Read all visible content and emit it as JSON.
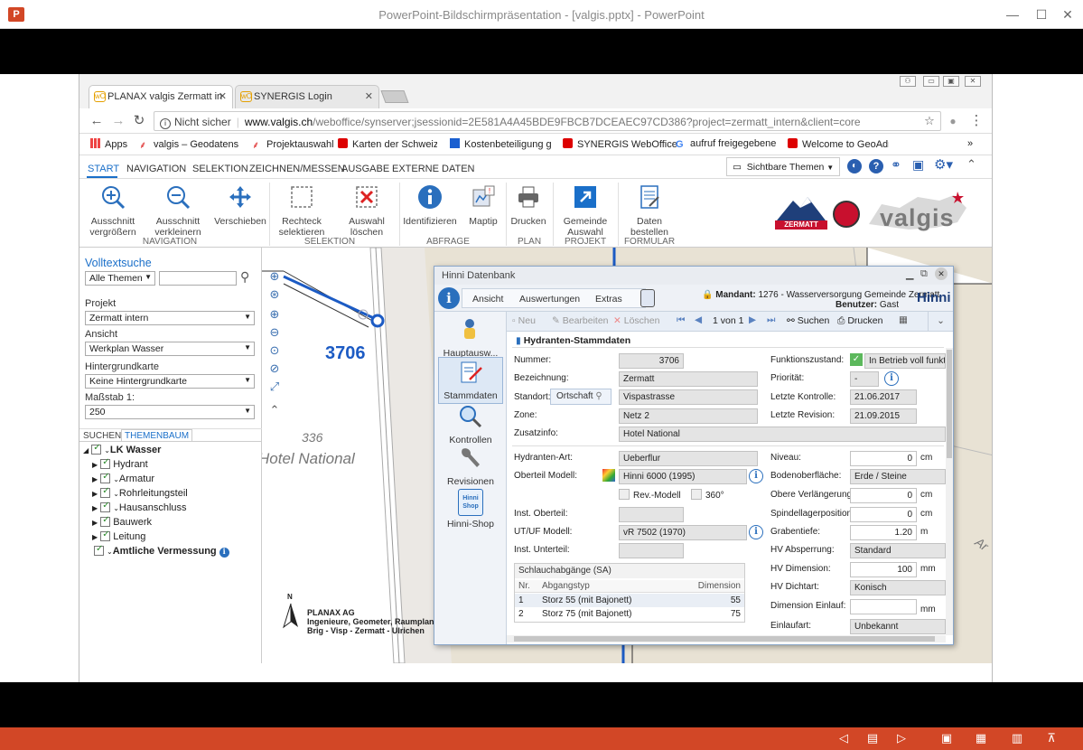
{
  "window": {
    "title": "PowerPoint-Bildschirmpräsentation - [valgis.pptx] - PowerPoint",
    "app_icon": "P"
  },
  "browser": {
    "tabs": [
      {
        "label": "PLANAX valgis Zermatt in"
      },
      {
        "label": "SYNERGIS Login"
      }
    ],
    "security": "Nicht sicher",
    "url_domain": "www.valgis.ch",
    "url_path": "/weboffice/synserver;jsessionid=2E581A4A45BDE9FBCB7DCEAEC97CD386?project=zermatt_intern&client=core",
    "bookmarks": [
      "Apps",
      "valgis – Geodatenser",
      "Projektauswahl",
      "Karten der Schweiz -",
      "Kostenbeteiligung ge",
      "SYNERGIS WebOffice",
      "aufruf freigegebener",
      "Welcome to GeoAdm"
    ],
    "more": "»"
  },
  "ribbon": {
    "tabs": [
      "START",
      "NAVIGATION",
      "SELEKTION",
      "ZEICHNEN/MESSEN",
      "AUSGABE",
      "EXTERNE DATEN"
    ],
    "themes": "Sichtbare Themen",
    "buttons": {
      "zoom_in": [
        "Ausschnitt",
        "vergrößern"
      ],
      "zoom_out": [
        "Ausschnitt",
        "verkleinern"
      ],
      "move": "Verschieben",
      "rect": [
        "Rechteck",
        "selektieren"
      ],
      "del": [
        "Auswahl",
        "löschen"
      ],
      "identify": "Identifizieren",
      "maptip": "Maptip",
      "print": "Drucken",
      "muni": [
        "Gemeinde",
        "Auswahl"
      ],
      "order": [
        "Daten",
        "bestellen"
      ]
    },
    "groups": [
      "NAVIGATION",
      "SELEKTION",
      "ABFRAGE",
      "PLAN",
      "PROJEKT",
      "FORMULAR"
    ],
    "logos": {
      "zermatt": "ZERMATT",
      "valgis": "valgis"
    }
  },
  "left": {
    "search_title": "Volltextsuche",
    "search_scope": "Alle Themen",
    "projekt_label": "Projekt",
    "projekt_value": "Zermatt intern",
    "ansicht_label": "Ansicht",
    "ansicht_value": "Werkplan Wasser",
    "hg_label": "Hintergrundkarte",
    "hg_value": "Keine Hintergrundkarte",
    "scale_label": "Maßstab 1:",
    "scale_value": "250",
    "tabs": [
      "SUCHEN",
      "THEMENBAUM"
    ],
    "tree": [
      "LK Wasser",
      "Hydrant",
      "Armatur",
      "Rohrleitungsteil",
      "Hausanschluss",
      "Bauwerk",
      "Leitung",
      "Amtliche Vermessung"
    ]
  },
  "map": {
    "hydrant_no": "3706",
    "parcel": "336",
    "building": "Hotel National",
    "company": "PLANAX AG",
    "company_line2": "Ingenieure, Geometer, Raumplaner",
    "company_line3": "Brig - Visp - Zermatt - Ulrichen",
    "north": "N",
    "road": "Ar"
  },
  "dialog": {
    "title": "Hinni Datenbank",
    "menu": [
      "Ansicht",
      "Auswertungen",
      "Extras"
    ],
    "mandant_label": "Mandant:",
    "mandant_value": "1276 - Wasserversorgung Gemeinde Zermatt",
    "benutzer_label": "Benutzer:",
    "benutzer_value": "Gast",
    "brand": "Hinni",
    "side": [
      "Hauptausw...",
      "Stammdaten",
      "Kontrollen",
      "Revisionen",
      "Hinni-Shop"
    ],
    "shop_icon": [
      "Hinni",
      "Shop"
    ],
    "toolbar": {
      "new": "Neu",
      "edit": "Bearbeiten",
      "del": "Löschen",
      "pager": "1 von 1",
      "search": "Suchen",
      "print": "Drucken"
    },
    "section": "Hydranten-Stammdaten",
    "fields": {
      "nummer_l": "Nummer:",
      "nummer_v": "3706",
      "bez_l": "Bezeichnung:",
      "bez_v": "Zermatt",
      "standort_l": "Standort:",
      "standort_btn": "Ortschaft",
      "standort_v": "Vispastrasse",
      "zone_l": "Zone:",
      "zone_v": "Netz 2",
      "zusatz_l": "Zusatzinfo:",
      "zusatz_v": "Hotel National",
      "funk_l": "Funktionszustand:",
      "funk_v": "In Betrieb voll funktio",
      "prio_l": "Priorität:",
      "prio_v": "-",
      "kontrolle_l": "Letzte Kontrolle:",
      "kontrolle_v": "21.06.2017",
      "revision_l": "Letzte Revision:",
      "revision_v": "21.09.2015",
      "art_l": "Hydranten-Art:",
      "art_v": "Ueberflur",
      "ober_l": "Oberteil Modell:",
      "ober_v": "Hinni 6000 (1995)",
      "rev_modell": "Rev.-Modell",
      "deg360": "360°",
      "inst_ober_l": "Inst. Oberteil:",
      "utuf_l": "UT/UF Modell:",
      "utuf_v": "vR 7502 (1970)",
      "inst_unter_l": "Inst. Unterteil:",
      "niveau_l": "Niveau:",
      "niveau_v": "0",
      "niveau_u": "cm",
      "boden_l": "Bodenoberfläche:",
      "boden_v": "Erde / Steine",
      "obere_l": "Obere Verlängerung:",
      "obere_v": "0",
      "obere_u": "cm",
      "spindel_l": "Spindellagerposition:",
      "spindel_v": "0",
      "spindel_u": "cm",
      "graben_l": "Grabentiefe:",
      "graben_v": "1.20",
      "graben_u": "m",
      "hvabs_l": "HV Absperrung:",
      "hvabs_v": "Standard",
      "hvdim_l": "HV Dimension:",
      "hvdim_v": "100",
      "hvdim_u": "mm",
      "hvdicht_l": "HV Dichtart:",
      "hvdicht_v": "Konisch",
      "dimein_l": "Dimension Einlauf:",
      "dimein_u": "mm",
      "einlauf_l": "Einlaufart:",
      "einlauf_v": "Unbekannt"
    },
    "schlauch": {
      "title": "Schlauchabgänge (SA)",
      "headers": [
        "Nr.",
        "Abgangstyp",
        "Dimension"
      ],
      "rows": [
        [
          "1",
          "Storz 55 (mit Bajonett)",
          "55"
        ],
        [
          "2",
          "Storz 75 (mit Bajonett)",
          "75"
        ]
      ]
    }
  },
  "colors": {
    "accent": "#1a6fc9",
    "ppt": "#d24726",
    "hydrant_number": "#1c5bc4"
  }
}
